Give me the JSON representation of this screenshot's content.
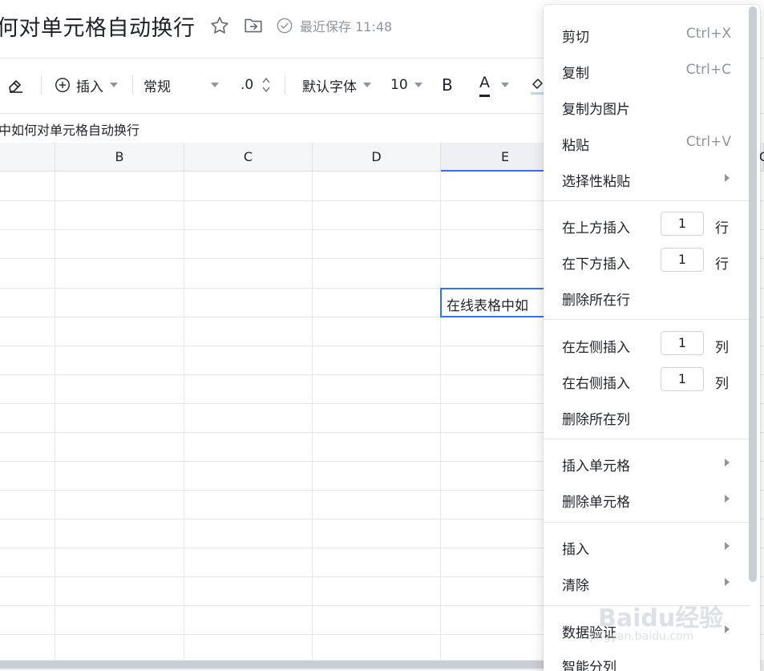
{
  "document": {
    "title": "何对单元格自动换行",
    "save_status": "最近保存 11:48"
  },
  "toolbar": {
    "insert_label": "插入",
    "format_label": "常规",
    "decimal_label": ".0",
    "font_label": "默认字体",
    "font_size_label": "10",
    "bold_label": "B",
    "font_color_label": "A"
  },
  "formula_bar": {
    "content": "中如何对单元格自动换行"
  },
  "grid": {
    "columns": [
      "B",
      "C",
      "D",
      "E"
    ],
    "active_column": "E",
    "next_column_partial": "C",
    "selected_cell_text": "在线表格中如"
  },
  "context_menu": {
    "cut": {
      "label": "剪切",
      "shortcut": "Ctrl+X"
    },
    "copy": {
      "label": "复制",
      "shortcut": "Ctrl+C"
    },
    "copy_as_image": {
      "label": "复制为图片"
    },
    "paste": {
      "label": "粘贴",
      "shortcut": "Ctrl+V"
    },
    "paste_special": {
      "label": "选择性粘贴"
    },
    "insert_row_above": {
      "label": "在上方插入",
      "count": "1",
      "unit": "行"
    },
    "insert_row_below": {
      "label": "在下方插入",
      "count": "1",
      "unit": "行"
    },
    "delete_row": {
      "label": "删除所在行"
    },
    "insert_col_left": {
      "label": "在左侧插入",
      "count": "1",
      "unit": "列"
    },
    "insert_col_right": {
      "label": "在右侧插入",
      "count": "1",
      "unit": "列"
    },
    "delete_col": {
      "label": "删除所在列"
    },
    "insert_cells": {
      "label": "插入单元格"
    },
    "delete_cells": {
      "label": "删除单元格"
    },
    "insert": {
      "label": "插入"
    },
    "clear": {
      "label": "清除"
    },
    "data_validation": {
      "label": "数据验证"
    },
    "smart_split": {
      "label": "智能分列"
    }
  },
  "watermark": {
    "text": "Baidu经验",
    "sub": "jingyan.baidu.com"
  },
  "colors": {
    "accent": "#3370ff",
    "text": "#1f2329",
    "muted": "#8f959e",
    "grid": "#e5e6eb"
  }
}
